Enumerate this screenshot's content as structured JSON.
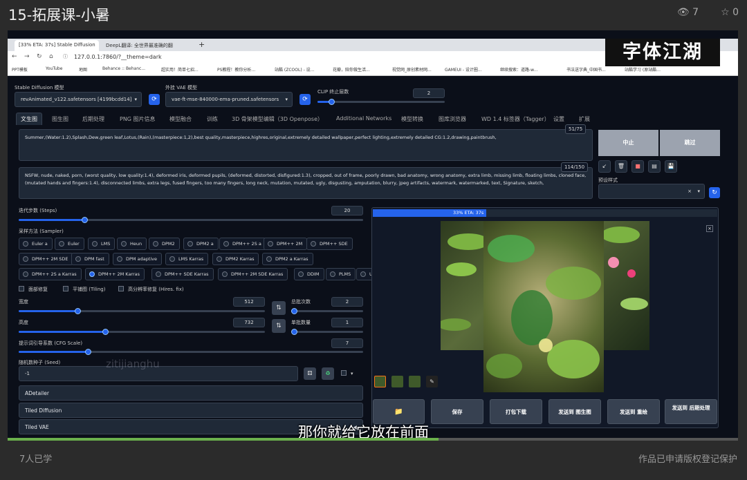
{
  "header": {
    "title": "15-拓展课-小暑",
    "views": "7",
    "stars": "0"
  },
  "footer": {
    "learners": "7人已学",
    "copyright": "作品已申请版权登记保护"
  },
  "watermark": "字体江湖",
  "browser": {
    "tabs": [
      "[33% ETA: 37s] Stable Diffusion",
      "DeepL翻译: 全世界最准确的翻"
    ],
    "url": "127.0.0.1:7860/?__theme=dark",
    "bookmarks": [
      "PPT模板",
      "YouTube",
      "地图",
      "Behance :: Behanc...",
      "超实用！简单七招...",
      "PS教程！教你分析...",
      "站酷 (ZCOOL) - 设...",
      "花瓣，陪你做生活...",
      "视觉网_原创素材网...",
      "GAMEUI - 设计圈...",
      "继续搜索：道路-w...",
      "书法送字典_中国书...",
      "站酷学习 (原站酷..."
    ]
  },
  "app": {
    "model_label": "Stable Diffusion 模型",
    "model_value": "revAnimated_v122.safetensors [4199bcdd14]",
    "vae_label": "外挂 VAE 模型",
    "vae_value": "vae-ft-mse-840000-ema-pruned.safetensors",
    "clip_label": "CLIP 终止层数",
    "clip_value": "2",
    "tabs": [
      "文生图",
      "图生图",
      "后期处理",
      "PNG 图片信息",
      "模型融合",
      "训练",
      "3D 骨架模型编辑（3D Openpose）",
      "Additional Networks",
      "模型转换",
      "图库浏览器",
      "WD 1.4 标签器（Tagger）",
      "设置",
      "扩展"
    ],
    "prompt": "Summer,(Water:1.2),Splash,Dew,green leaf,Lotus,(Rain),(masterpiece:1,2),best quality,masterpiece,highres,original,extremely detailed wallpaper,perfect lighting,extremely detailed CG:1.2,drawing,paintbrush,",
    "prompt_tokens": "51/75",
    "neg_prompt": "NSFW, nude, naked, porn, (worst quality, low quality:1.4), deformed iris, deformed pupils, (deformed, distorted, disfigured:1.3), cropped, out of frame, poorly drawn, bad anatomy, wrong anatomy, extra limb, missing limb, floating limbs, cloned face, (mutated hands and fingers:1.4), disconnected limbs, extra legs, fused fingers, too many fingers, long neck, mutation, mutated, ugly, disgusting, amputation, blurry, jpeg artifacts, watermark, watermarked, text, Signature, sketch,",
    "neg_tokens": "114/150",
    "interrupt": "中止",
    "skip": "跳过",
    "style_label": "预设样式",
    "style_close": "×",
    "steps_label": "迭代步数 (Steps)",
    "steps": "20",
    "steps_frac": 0.19,
    "sampler_label": "采样方法 (Sampler)",
    "samplers": [
      "Euler a",
      "Euler",
      "LMS",
      "Heun",
      "DPM2",
      "DPM2 a",
      "DPM++ 2S a",
      "DPM++ 2M",
      "DPM++ SDE",
      "DPM++ 2M SDE",
      "DPM fast",
      "DPM adaptive",
      "LMS Karras",
      "DPM2 Karras",
      "DPM2 a Karras",
      "DPM++ 2S a Karras",
      "DPM++ 2M Karras",
      "DPM++ SDE Karras",
      "DPM++ 2M SDE Karras",
      "DDIM",
      "PLMS",
      "UniPC"
    ],
    "sampler_selected": "DPM++ 2M Karras",
    "face": "面部修复",
    "tiling": "平铺图 (Tiling)",
    "hires": "高分辨率修复 (Hires. fix)",
    "width_label": "宽度",
    "width": "512",
    "width_frac": 0.24,
    "height_label": "高度",
    "height": "732",
    "height_frac": 0.35,
    "batch_count_label": "总批次数",
    "batch_count": "2",
    "batch_count_frac": 0.01,
    "batch_size_label": "单批数量",
    "batch_size": "1",
    "batch_size_frac": 0.0,
    "cfg_label": "提示词引导系数 (CFG Scale)",
    "cfg": "7",
    "cfg_frac": 0.2,
    "seed_label": "随机数种子 (Seed)",
    "seed": "-1",
    "accordions": [
      "ADetailer",
      "Tiled Diffusion",
      "Tiled VAE"
    ],
    "progress_text": "33% ETA: 37s",
    "outputs": [
      "保存",
      "打包下载",
      "发送到 图生图",
      "发送到 重绘",
      "发送到 后期处理"
    ]
  },
  "subtitle": "那你就给它放在前面",
  "overlay_text": "zitijianghu",
  "overlay_cn": "zitijianghu",
  "colors": {
    "accent": "#2563eb",
    "bg": "#0b0f19",
    "panel": "#1f2937"
  }
}
